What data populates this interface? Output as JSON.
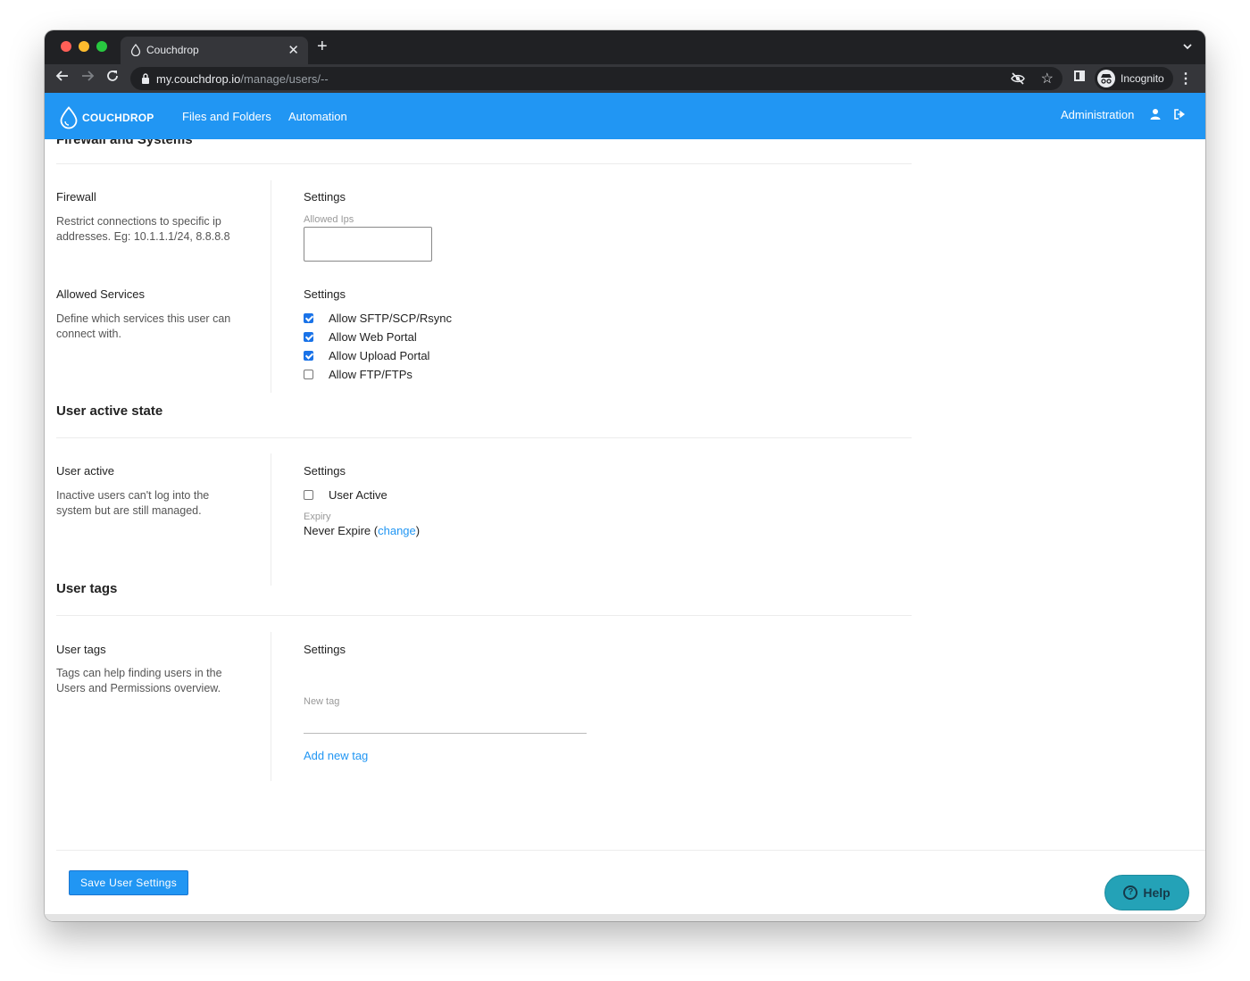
{
  "browser": {
    "tab_title": "Couchdrop",
    "url_host": "my.couchdrop.io",
    "url_path": "/manage/users/--",
    "profile_label": "Incognito",
    "new_tab_symbol": "+",
    "close_symbol": "✕"
  },
  "app": {
    "brand": "COUCHDROP",
    "nav": [
      "Files and Folders",
      "Automation"
    ],
    "admin_link": "Administration"
  },
  "firewall_section": {
    "heading": "Firewall and Systems",
    "firewall": {
      "label": "Firewall",
      "description": "Restrict connections to specific ip addresses. Eg: 10.1.1.1/24, 8.8.8.8",
      "settings_label": "Settings",
      "field_label": "Allowed Ips",
      "field_value": ""
    },
    "services": {
      "label": "Allowed Services",
      "description": "Define which services this user can connect with.",
      "settings_label": "Settings",
      "options": [
        {
          "label": "Allow SFTP/SCP/Rsync",
          "checked": true
        },
        {
          "label": "Allow Web Portal",
          "checked": true
        },
        {
          "label": "Allow Upload Portal",
          "checked": true
        },
        {
          "label": "Allow FTP/FTPs",
          "checked": false
        }
      ]
    }
  },
  "active_section": {
    "heading": "User active state",
    "label": "User active",
    "description": "Inactive users can't log into the system but are still managed.",
    "settings_label": "Settings",
    "checkbox_label": "User Active",
    "checkbox_checked": false,
    "expiry_label": "Expiry",
    "expiry_value": "Never Expire",
    "expiry_open": "(",
    "expiry_change": "change",
    "expiry_close": ")"
  },
  "tags_section": {
    "heading": "User tags",
    "label": "User tags",
    "description": "Tags can help finding users in the Users and Permissions overview.",
    "settings_label": "Settings",
    "new_tag_label": "New tag",
    "new_tag_value": "",
    "add_link": "Add new tag"
  },
  "footer": {
    "save_label": "Save User Settings",
    "help_label": "Help"
  },
  "colors": {
    "brand_blue": "#2196f3",
    "help_teal": "#24a2b7",
    "browser_dark": "#202124"
  }
}
